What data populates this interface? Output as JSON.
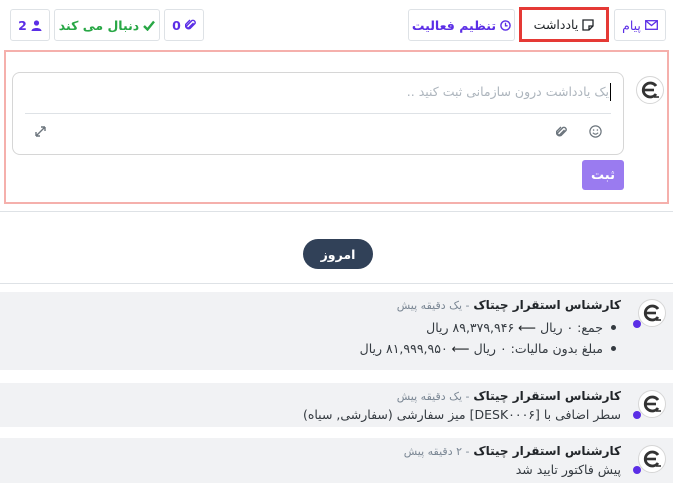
{
  "toolbar": {
    "followers_count": "2",
    "following_label": "دنبال می کند",
    "attachments_count": "0",
    "schedule_activity_label": "تنظیم فعالیت",
    "log_note_label": "یادداشت",
    "send_message_label": "پیام"
  },
  "composer": {
    "placeholder": "یک یادداشت درون سازمانی ثبت کنید ..",
    "submit_label": "ثبت"
  },
  "date_separator": "امروز",
  "messages": [
    {
      "author": "کارشناس استقرار چیتاک",
      "time": "- یک دقیقه پیش",
      "tracking": [
        {
          "field": "جمع:",
          "old": "۰ ریال",
          "new": "۸۹,۳۷۹,۹۴۶ ریال"
        },
        {
          "field": "مبلغ بدون مالیات:",
          "old": "۰ ریال",
          "new": "۸۱,۹۹۹,۹۵۰ ریال"
        }
      ]
    },
    {
      "author": "کارشناس استقرار چیتاک",
      "time": "- یک دقیقه پیش",
      "body": "سطر اضافی با [DESK۰۰۰۶] میز سفارشی (سفارشی, سیاه)"
    },
    {
      "author": "کارشناس استقرار چیتاک",
      "time": "- ۲ دقیقه پیش",
      "body": "پیش فاکتور تایید شد"
    }
  ],
  "colors": {
    "accent": "#5b2ee6",
    "follow_green": "#28a745",
    "highlight_red": "#e53935",
    "today_pill": "#314158",
    "submit_button": "#9a7bf0"
  }
}
